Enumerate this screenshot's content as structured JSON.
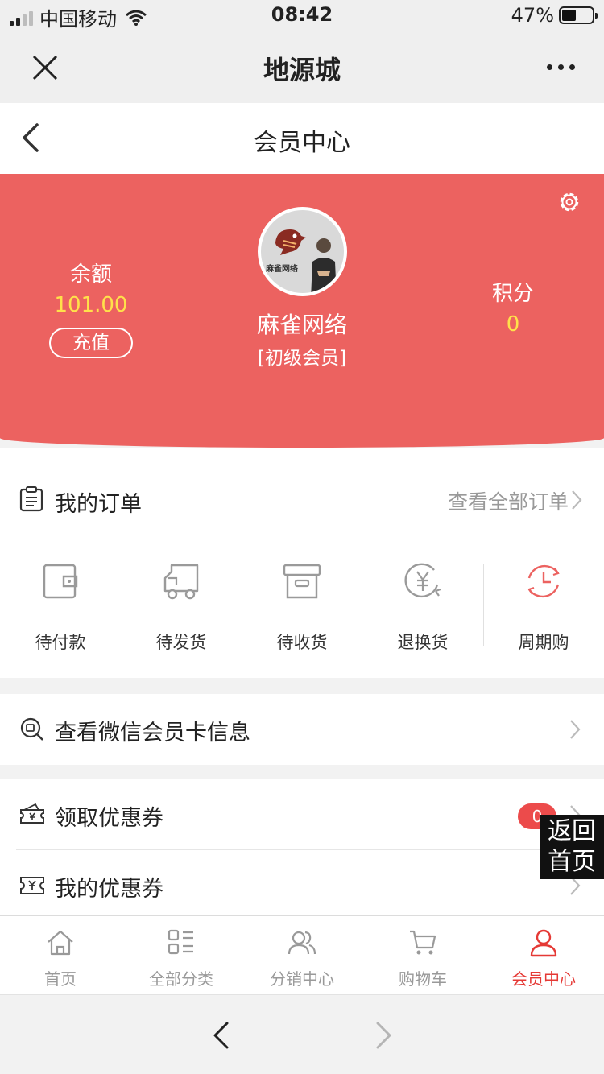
{
  "status_bar": {
    "carrier": "中国移动",
    "time": "08:42",
    "battery": "47%",
    "battery_level": 0.47
  },
  "wx_header": {
    "title": "地源城"
  },
  "page_header": {
    "title": "会员中心"
  },
  "member": {
    "balance_label": "余额",
    "balance_value": "101.00",
    "recharge_label": "充值",
    "name": "麻雀网络",
    "level": "[初级会员]",
    "points_label": "积分",
    "points_value": "0",
    "avatar_text": "麻雀网络"
  },
  "orders": {
    "title": "我的订单",
    "view_all": "查看全部订单",
    "items": [
      {
        "label": "待付款",
        "icon": "wallet-icon"
      },
      {
        "label": "待发货",
        "icon": "truck-icon"
      },
      {
        "label": "待收货",
        "icon": "box-icon"
      },
      {
        "label": "退换货",
        "icon": "yuan-refund-icon"
      },
      {
        "label": "周期购",
        "icon": "clock-cycle-icon"
      }
    ]
  },
  "rows": {
    "wechat_card": "查看微信会员卡信息",
    "claim_coupon": "领取优惠券",
    "claim_coupon_badge": "0",
    "my_coupons": "我的优惠券"
  },
  "float_button": {
    "line1": "返回",
    "line2": "首页"
  },
  "tabbar": {
    "items": [
      {
        "label": "首页",
        "icon": "home-icon"
      },
      {
        "label": "全部分类",
        "icon": "category-icon"
      },
      {
        "label": "分销中心",
        "icon": "users-icon"
      },
      {
        "label": "购物车",
        "icon": "cart-icon"
      },
      {
        "label": "会员中心",
        "icon": "user-icon"
      }
    ],
    "active_index": 4
  },
  "colors": {
    "banner": "#ec6260",
    "accent": "#e53935",
    "balance_text": "#ffe14a"
  }
}
